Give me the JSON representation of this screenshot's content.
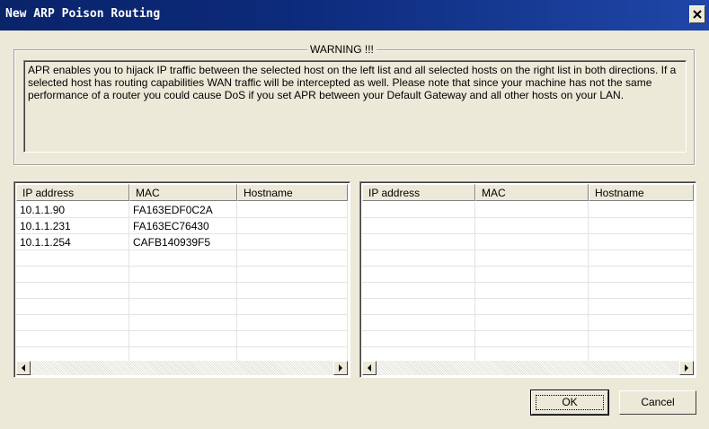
{
  "window": {
    "title": "New ARP Poison Routing"
  },
  "warning": {
    "legend": "WARNING !!!",
    "text": "APR enables you to hijack IP traffic between the selected host on the left list and all selected hosts on the right list in both directions. If a selected host has routing capabilities WAN traffic will be intercepted as well. Please note that since your machine has not the same performance of a router you could cause DoS if you set APR between your Default Gateway and all other hosts on your LAN."
  },
  "left_list": {
    "columns": [
      "IP address",
      "MAC",
      "Hostname"
    ],
    "rows": [
      [
        "10.1.1.90",
        "FA163EDF0C2A",
        ""
      ],
      [
        "10.1.1.231",
        "FA163EC76430",
        ""
      ],
      [
        "10.1.1.254",
        "CAFB140939F5",
        ""
      ]
    ]
  },
  "right_list": {
    "columns": [
      "IP address",
      "MAC",
      "Hostname"
    ],
    "rows": []
  },
  "buttons": {
    "ok_label": "OK",
    "cancel_label": "Cancel"
  },
  "icons": {
    "close": "close-icon",
    "scroll_left": "arrow-left-icon",
    "scroll_right": "arrow-right-icon"
  }
}
